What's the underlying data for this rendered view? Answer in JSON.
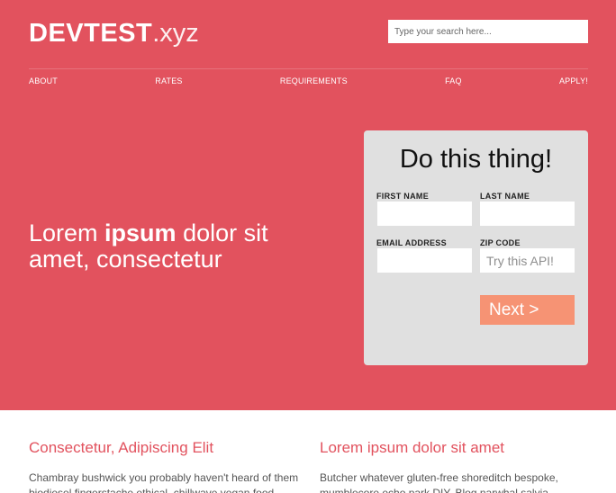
{
  "brand": {
    "bold": "DEVTEST",
    "light": ".xyz"
  },
  "search": {
    "placeholder": "Type your search here..."
  },
  "nav": {
    "items": [
      "ABOUT",
      "RATES",
      "REQUIREMENTS",
      "FAQ",
      "APPLY!"
    ]
  },
  "hero": {
    "tagline_part1": "Lorem ",
    "tagline_bold": "ipsum",
    "tagline_part2": " dolor sit amet, consectetur"
  },
  "form": {
    "title": "Do this thing!",
    "first_name_label": "FIRST NAME",
    "last_name_label": "LAST NAME",
    "email_label": "EMAIL ADDRESS",
    "zip_label": "ZIP CODE",
    "zip_placeholder": "Try this API!",
    "next_label": "Next >"
  },
  "columns": [
    {
      "title": "Consectetur, Adipiscing Elit",
      "body": "Chambray bushwick you probably haven't heard of them biodiesel fingerstache ethical, chillwave vegan food"
    },
    {
      "title": "Lorem ipsum dolor sit amet",
      "body": "Butcher whatever gluten-free shoreditch bespoke, mumblecore echo park DIY. Blog narwhal salvia"
    }
  ],
  "colors": {
    "hero_background": "#e2525e",
    "form_background": "#e0e0e0",
    "button": "#f69374",
    "heading_accent": "#e2525e"
  }
}
